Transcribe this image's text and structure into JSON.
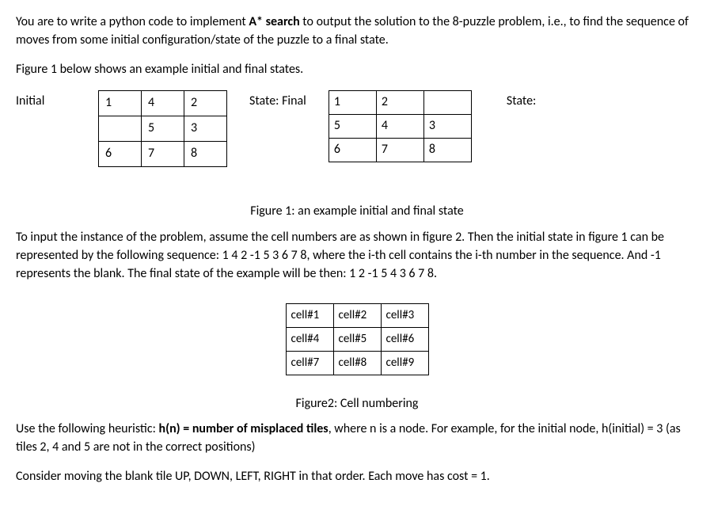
{
  "intro": {
    "p1a": "You are to write a python code to implement ",
    "p1b": "A* search",
    "p1c": " to output the solution to the 8-puzzle problem, i.e., to find the sequence of moves from some initial configuration/state of the puzzle to a final state.",
    "p2": "Figure 1 below shows an example initial and final states."
  },
  "fig1": {
    "label_initial": "Initial",
    "label_state_final": "State:  Final",
    "label_state": "State:",
    "initial_grid": [
      [
        "1",
        "4",
        "2"
      ],
      [
        "",
        "5",
        "3"
      ],
      [
        "6",
        "7",
        "8"
      ]
    ],
    "final_grid": [
      [
        "1",
        "2",
        ""
      ],
      [
        "5",
        "4",
        "3"
      ],
      [
        "6",
        "7",
        "8"
      ]
    ],
    "caption": "Figure 1: an example initial and final state"
  },
  "encoding": {
    "p1": "To input the instance of the problem, assume the cell numbers are as shown in figure 2. Then the initial state in figure 1 can be represented by the following sequence: 1 4 2 -1 5 3 6 7 8, where the i-th cell contains the i-th number in the sequence. And -1 represents the blank. The final state of the example will be then: 1 2 -1 5 4 3 6 7 8."
  },
  "fig2": {
    "cells": [
      [
        "cell#1",
        "cell#2",
        "cell#3"
      ],
      [
        "cell#4",
        "cell#5",
        "cell#6"
      ],
      [
        "cell#7",
        "cell#8",
        "cell#9"
      ]
    ],
    "caption": "Figure2: Cell numbering"
  },
  "heuristic": {
    "p1a": "Use the following heuristic: ",
    "p1b": "h(n) = number of misplaced tiles",
    "p1c": ", where n is a node. For example, for the initial node, h(initial) = 3 (as tiles 2, 4 and 5 are not in the correct positions)",
    "p2": "Consider moving the blank tile UP, DOWN, LEFT, RIGHT in that order. Each move has cost = 1."
  }
}
